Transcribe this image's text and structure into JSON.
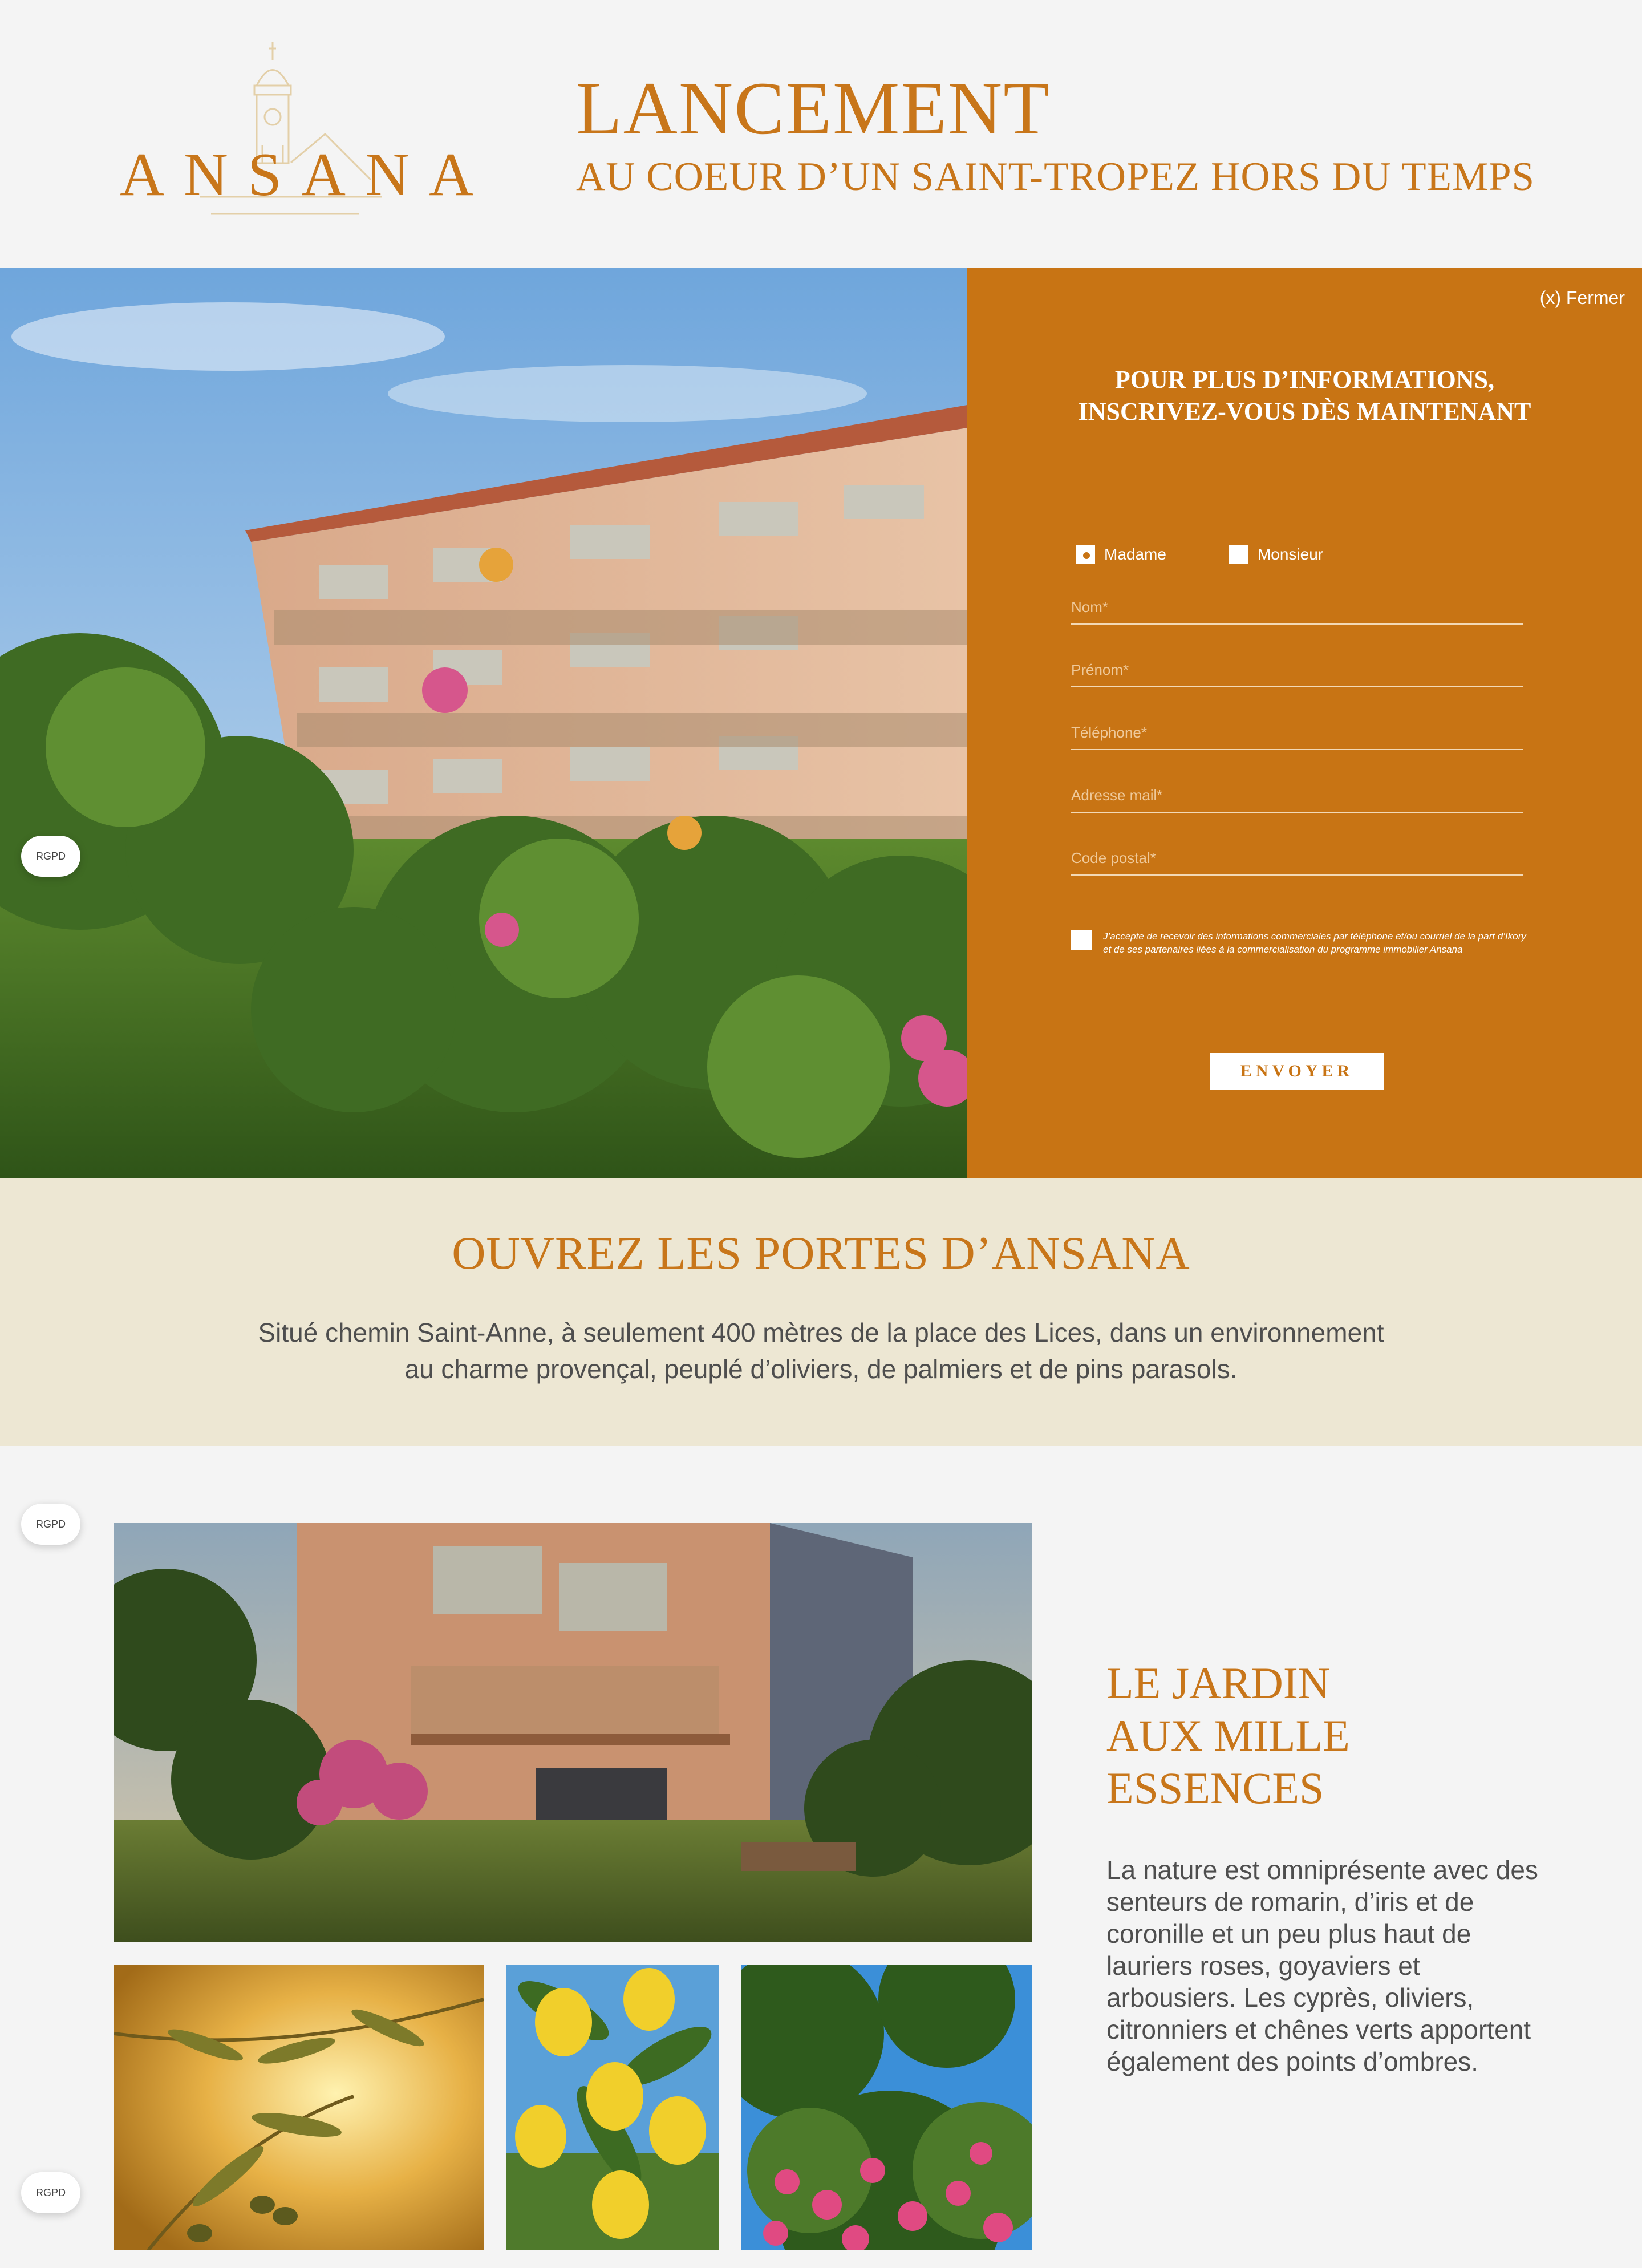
{
  "header": {
    "logo_text": "ANSANA",
    "title": "LANCEMENT",
    "subtitle": "AU COEUR D’UN SAINT-TROPEZ HORS DU TEMPS"
  },
  "form": {
    "close_label": "(x) Fermer",
    "title_line1": "POUR PLUS D’INFORMATIONS,",
    "title_line2": "INSCRIVEZ-VOUS DÈS MAINTENANT",
    "gender_options": [
      "Madame",
      "Monsieur"
    ],
    "gender_selected": "Madame",
    "fields": {
      "nom": "Nom*",
      "prenom": "Prénom*",
      "telephone": "Téléphone*",
      "email": "Adresse mail*",
      "postal": "Code postal*"
    },
    "consent": "J’accepte de recevoir des informations commerciales par téléphone et/ou courriel de la part d’Ikory et de ses partenaires liées à la commercialisation du programme immobilier Ansana",
    "submit_label": "ENVOYER"
  },
  "rgpd_label": "RGPD",
  "intro": {
    "title": "OUVREZ LES PORTES D’ANSANA",
    "text_line1": "Situé chemin Saint-Anne, à seulement 400 mètres de la place des Lices, dans un environnement",
    "text_line2": "au charme provençal, peuplé d’oliviers, de palmiers et de pins parasols."
  },
  "garden": {
    "title_line1": "LE JARDIN",
    "title_line2": "AUX MILLE",
    "title_line3": "ESSENCES",
    "text": "La nature est omniprésente avec des senteurs de romarin, d’iris et de coronille et un peu plus haut de lauriers roses, goyaviers et arbousiers. Les cyprès, oliviers, citronniers et chênes verts apportent également des points d’ombres."
  },
  "colors": {
    "brand": "#c8761a",
    "panel": "#c87414",
    "band": "#ede7d3"
  }
}
